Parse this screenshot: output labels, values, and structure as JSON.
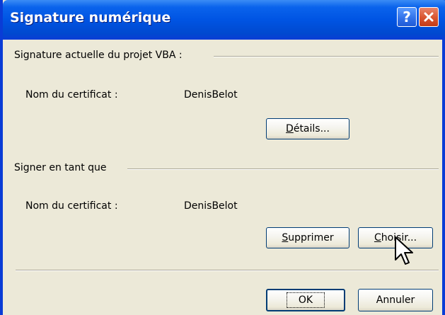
{
  "window": {
    "title": "Signature numérique",
    "help_glyph": "?"
  },
  "current_signature": {
    "section_label": "Signature actuelle du projet VBA :",
    "cert_label": "Nom du certificat :",
    "cert_value": "DenisBelot",
    "details_button": {
      "mnemonic": "D",
      "rest": "étails..."
    }
  },
  "sign_as": {
    "section_label": "Signer en tant que",
    "cert_label": "Nom du certificat :",
    "cert_value": "DenisBelot",
    "remove_button": {
      "mnemonic": "S",
      "rest": "upprimer"
    },
    "choose_button": {
      "mnemonic": "C",
      "rest": "hoisir..."
    }
  },
  "footer": {
    "ok_label": "OK",
    "cancel_label": "Annuler"
  },
  "colors": {
    "titlebar": "#0054e3",
    "dialog_bg": "#ece9d8",
    "close_button": "#d9542f"
  },
  "icons": [
    "help-icon",
    "close-icon",
    "mouse-pointer-icon"
  ]
}
